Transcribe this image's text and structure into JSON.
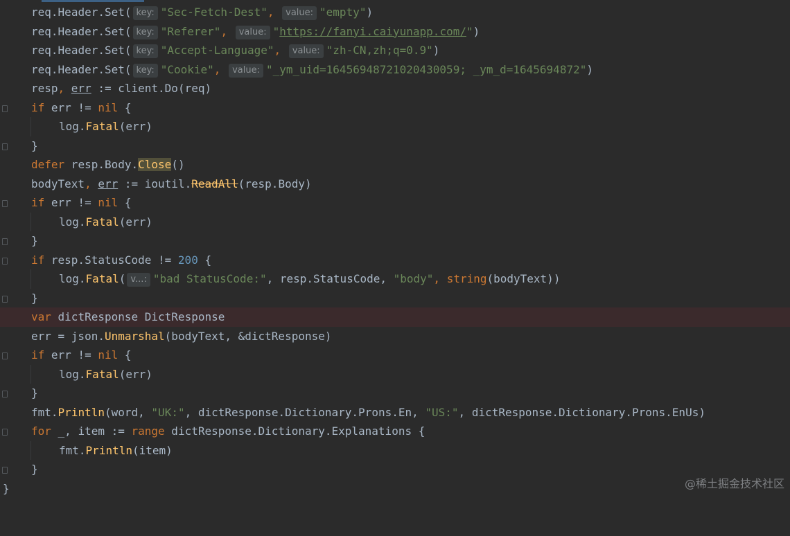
{
  "editor": {
    "lines": {
      "l1": {
        "obj": "req",
        "dot": ".",
        "prop": "Header",
        "dot2": ".",
        "method": "Set",
        "open": "(",
        "hint_key": "key:",
        "key": "\"Sec-Fetch-Dest\"",
        "comma": ",",
        "hint_value": "value:",
        "value": "\"empty\"",
        "close": ")"
      },
      "l2": {
        "obj": "req",
        "dot": ".",
        "prop": "Header",
        "dot2": ".",
        "method": "Set",
        "open": "(",
        "hint_key": "key:",
        "key": "\"Referer\"",
        "comma": ",",
        "hint_value": "value:",
        "q1": "\"",
        "url": "https://fanyi.caiyunapp.com/",
        "q2": "\"",
        "close": ")"
      },
      "l3": {
        "obj": "req",
        "dot": ".",
        "prop": "Header",
        "dot2": ".",
        "method": "Set",
        "open": "(",
        "hint_key": "key:",
        "key": "\"Accept-Language\"",
        "comma": ",",
        "hint_value": "value:",
        "value": "\"zh-CN,zh;q=0.9\"",
        "close": ")"
      },
      "l4": {
        "obj": "req",
        "dot": ".",
        "prop": "Header",
        "dot2": ".",
        "method": "Set",
        "open": "(",
        "hint_key": "key:",
        "key": "\"Cookie\"",
        "comma": ",",
        "hint_value": "value:",
        "value": "\"_ym_uid=16456948721020430059; _ym_d=1645694872\"",
        "close": ")"
      },
      "l5": {
        "a": "resp",
        "comma": ", ",
        "b": "err",
        "op": " := ",
        "c": "client",
        "dot": ".",
        "fn": "Do",
        "args": "(req)"
      },
      "l6": {
        "kw": "if",
        "mid": " err != ",
        "nil": "nil",
        "brace": " {"
      },
      "l7": {
        "obj": "log",
        "dot": ".",
        "fn": "Fatal",
        "args": "(err)"
      },
      "l8": {
        "brace": "}"
      },
      "l9": {
        "kw": "defer",
        "mid": " resp.Body.",
        "fn": "Close",
        "args": "()"
      },
      "l10": {
        "a": "bodyText",
        "comma": ", ",
        "b": "err",
        "op": " := ",
        "c": "ioutil",
        "dot": ".",
        "fn": "ReadAll",
        "args": "(resp.Body)"
      },
      "l11": {
        "kw": "if",
        "mid": " err != ",
        "nil": "nil",
        "brace": " {"
      },
      "l12": {
        "obj": "log",
        "dot": ".",
        "fn": "Fatal",
        "args": "(err)"
      },
      "l13": {
        "brace": "}"
      },
      "l14": {
        "kw": "if",
        "mid": " resp.StatusCode != ",
        "num": "200",
        "brace": " {"
      },
      "l15": {
        "obj": "log",
        "dot": ".",
        "fn": "Fatal",
        "open": "(",
        "hint": "v...:",
        "s1": "\"bad StatusCode:\"",
        "mid": ", resp.StatusCode, ",
        "s2": "\"body\"",
        "comma": ", ",
        "fn2": "string",
        "args": "(bodyText))"
      },
      "l16": {
        "brace": "}"
      },
      "l17": {
        "kw": "var",
        "mid": " dictResponse ",
        "type": "DictResponse"
      },
      "l18": {
        "a": "err = ",
        "obj": "json",
        "dot": ".",
        "fn": "Unmarshal",
        "args": "(bodyText, &dictResponse)"
      },
      "l19": {
        "kw": "if",
        "mid": " err != ",
        "nil": "nil",
        "brace": " {"
      },
      "l20": {
        "obj": "log",
        "dot": ".",
        "fn": "Fatal",
        "args": "(err)"
      },
      "l21": {
        "brace": "}"
      },
      "l22": {
        "obj": "fmt",
        "dot": ".",
        "fn": "Println",
        "a": "(word, ",
        "s1": "\"UK:\"",
        "b": ", dictResponse.Dictionary.Prons.En, ",
        "s2": "\"US:\"",
        "c": ", dictResponse.Dictionary.Prons.EnUs)"
      },
      "l23": {
        "kw": "for",
        "a": " _, item := ",
        "kw2": "range",
        "b": " dictResponse.Dictionary.Explanations {"
      },
      "l24": {
        "obj": "fmt",
        "dot": ".",
        "fn": "Println",
        "args": "(item)"
      },
      "l25": {
        "brace": "}"
      },
      "l26": {
        "brace": "}"
      }
    }
  },
  "watermark": "@稀土掘金技术社区",
  "colors": {
    "background": "#2b2b2b",
    "keyword": "#cc7832",
    "string": "#6a8759",
    "number": "#6897bb",
    "function": "#ffc66d",
    "identifier": "#a9b7c6",
    "highlight_line": "#3b2a2c"
  },
  "icons": {
    "fold_marker": "fold-marker-icon"
  }
}
